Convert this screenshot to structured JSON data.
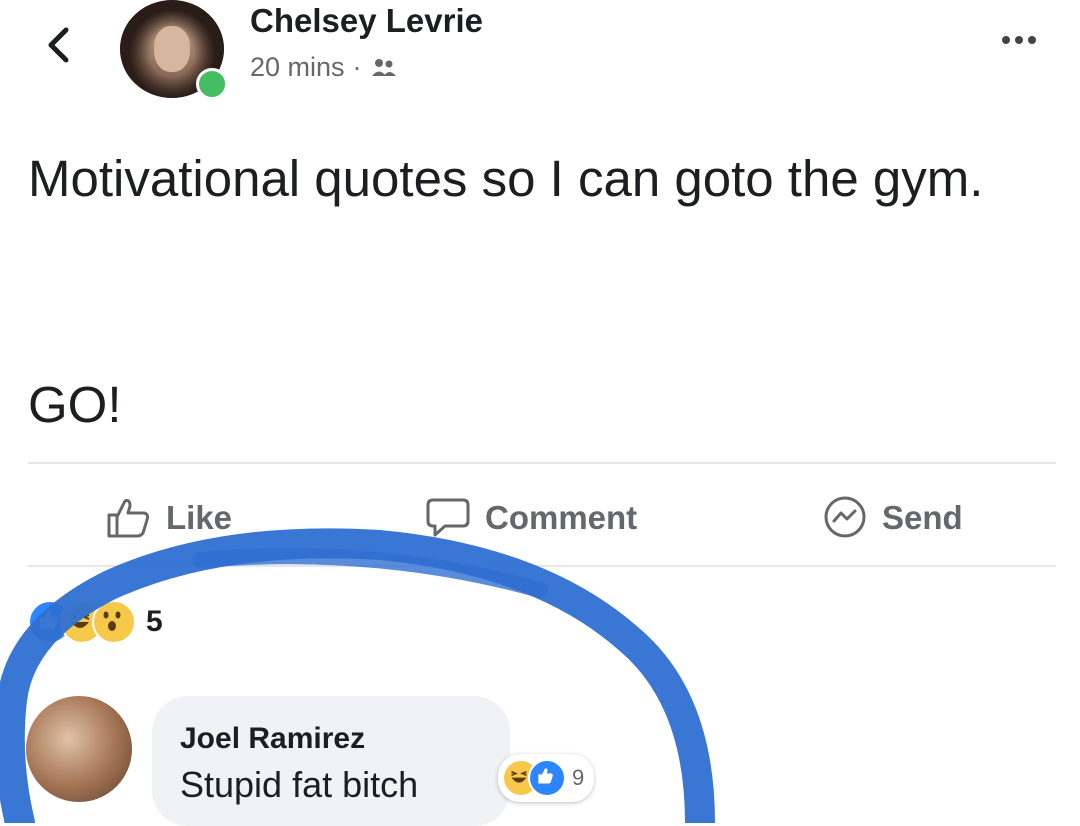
{
  "header": {
    "author_name": "Chelsey Levrie",
    "time": "20 mins",
    "separator": "·",
    "audience_icon": "friends-icon",
    "back_icon": "chevron-left-icon",
    "more_icon": "more-horizontal-icon"
  },
  "post": {
    "line1": "Motivational quotes so I can goto the gym.",
    "line2": "GO!"
  },
  "actions": {
    "like_label": "Like",
    "comment_label": "Comment",
    "send_label": "Send"
  },
  "reactions": {
    "types": [
      "like",
      "laugh",
      "wow"
    ],
    "count": "5"
  },
  "comment": {
    "author": "Joel Ramirez",
    "text": "Stupid fat bitch",
    "reaction_types": [
      "laugh",
      "like"
    ],
    "reaction_count": "9"
  },
  "colors": {
    "accent_blue": "#2d86ff",
    "online_green": "#45bd62",
    "annotation_blue": "#2f6fd1",
    "bubble_bg": "#f0f2f5"
  }
}
